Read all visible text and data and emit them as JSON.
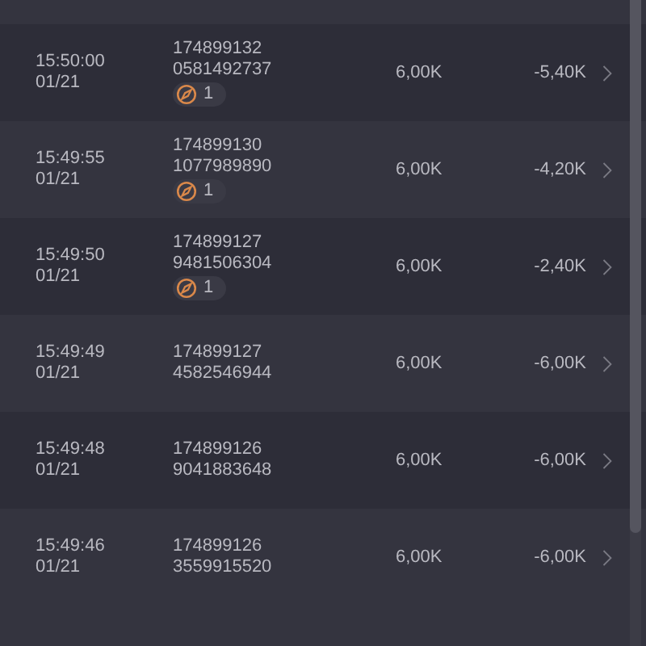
{
  "rows": [
    {
      "time": "15:50:00",
      "date": "01/21",
      "id_line1": "174899132",
      "id_line2": "0581492737",
      "badge": "1",
      "amount": "6,00K",
      "result": "-5,40K"
    },
    {
      "time": "15:49:55",
      "date": "01/21",
      "id_line1": "174899130",
      "id_line2": "1077989890",
      "badge": "1",
      "amount": "6,00K",
      "result": "-4,20K"
    },
    {
      "time": "15:49:50",
      "date": "01/21",
      "id_line1": "174899127",
      "id_line2": "9481506304",
      "badge": "1",
      "amount": "6,00K",
      "result": "-2,40K"
    },
    {
      "time": "15:49:49",
      "date": "01/21",
      "id_line1": "174899127",
      "id_line2": "4582546944",
      "amount": "6,00K",
      "result": "-6,00K"
    },
    {
      "time": "15:49:48",
      "date": "01/21",
      "id_line1": "174899126",
      "id_line2": "9041883648",
      "amount": "6,00K",
      "result": "-6,00K"
    },
    {
      "time": "15:49:46",
      "date": "01/21",
      "id_line1": "174899126",
      "id_line2": "3559915520",
      "amount": "6,00K",
      "result": "-6,00K"
    }
  ]
}
